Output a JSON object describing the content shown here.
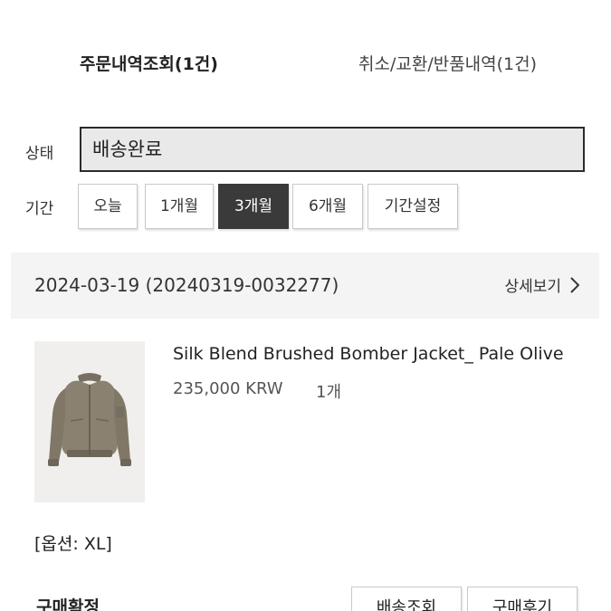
{
  "tabs": {
    "orders_label": "주문내역조회(1건)",
    "cancel_label": "취소/교환/반품내역(1건)"
  },
  "filters": {
    "status_label": "상태",
    "status_value": "배송완료",
    "period_label": "기간",
    "period_options": [
      {
        "label": "오늘",
        "selected": false
      },
      {
        "label": "1개월",
        "selected": false
      },
      {
        "label": "3개월",
        "selected": true
      },
      {
        "label": "6개월",
        "selected": false
      },
      {
        "label": "기간설정",
        "selected": false
      }
    ]
  },
  "order": {
    "date_label": "2024-03-19 (20240319-0032277)",
    "detail_link": "상세보기",
    "product": {
      "name": "Silk Blend Brushed Bomber Jacket_ Pale Olive",
      "price": "235,000 KRW",
      "quantity": "1개",
      "option": "[옵션: XL]"
    },
    "purchase_confirm_label": "구매확정",
    "tracking_button": "배송조회",
    "review_button": "구매후기"
  },
  "colors": {
    "jacket": "#8a8171",
    "active_button": "#3a3a3a",
    "status_field_bg": "#e9e9e9"
  }
}
